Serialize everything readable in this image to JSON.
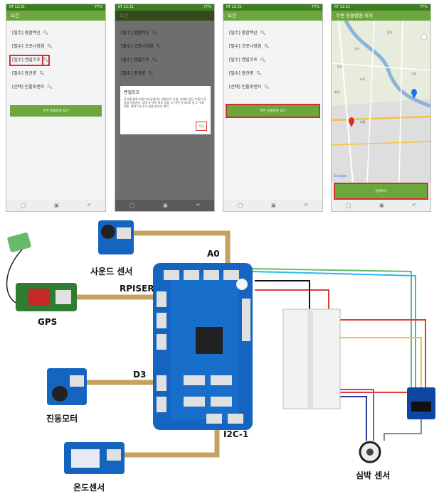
{
  "status": {
    "carrier": "KT 12:31",
    "right": "77%"
  },
  "app_title": "보건",
  "map_title": "주변 동물병원 위치",
  "items": [
    "[필수] 종합백신",
    "[필수] 코로나장염",
    "[필수] 켄넬코프",
    "[필수] 광견병",
    "[선택] 인플루엔자"
  ],
  "find_button": "주변 동물병원 찾기",
  "search_button": "검색하기",
  "dialog": {
    "title": "켄넬코프",
    "body": "공기를 통해 호흡기에 감염되는 질병으로 기침, 가래와 같은 호흡기 증상을 유발한다. 생후 6~8주 최초 접종, 2~3주 간격으로 총 2~3회 접종, 매년 1회 추가 접종 받아야 한다.",
    "ok": "확인"
  },
  "map_labels": [
    "창동",
    "동촌",
    "동호",
    "효목",
    "신암",
    "칠성",
    "대명",
    "Google"
  ],
  "diagram_labels": {
    "a0": "A0",
    "rpiser": "RPISER",
    "d3": "D3",
    "i2c": "I2C-1",
    "gps": "GPS",
    "sound": "사운드 센서",
    "vibration": "진동모터",
    "temp": "온도센서",
    "heart": "심박 센서"
  },
  "colors": {
    "green_bar": "#6da63d",
    "status": "#3f7d23",
    "highlight": "#d32f2f",
    "board": "#1565c0"
  }
}
